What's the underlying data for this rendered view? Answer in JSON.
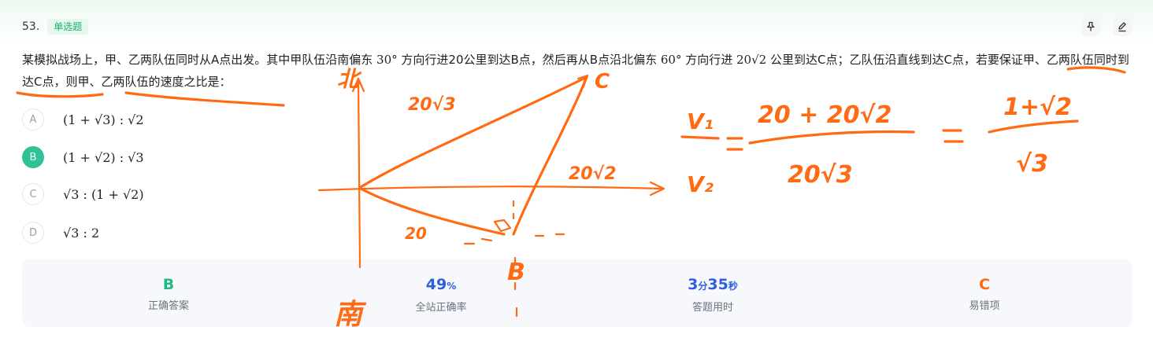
{
  "question": {
    "number": "53.",
    "type": "单选题",
    "stem_parts": [
      "某模拟战场上，甲、乙两队伍同时从A点出发。其中甲队伍沿南偏东 ",
      "30°",
      " 方向行进20公里到达B点，然后再从B点沿北偏东 ",
      "60°",
      " 方向行进 ",
      "20√2",
      " 公里到达C点；乙队伍沿直线到达C点，若要保证甲、乙两队伍同时到达C点，则甲、乙两队伍的速度之比是："
    ]
  },
  "toolbar": {
    "pin_icon": "pin-icon",
    "edit_icon": "edit-icon"
  },
  "options": [
    {
      "letter": "A",
      "text": "(1 + √3) : √2",
      "selected": false
    },
    {
      "letter": "B",
      "text": "(1 + √2) : √3",
      "selected": true
    },
    {
      "letter": "C",
      "text": "√3 : (1 + √2)",
      "selected": false
    },
    {
      "letter": "D",
      "text": "√3 : 2",
      "selected": false
    }
  ],
  "stats": {
    "answer": {
      "value": "B",
      "label": "正确答案",
      "color": "#20b97f"
    },
    "accuracy": {
      "value": "49",
      "unit": "%",
      "label": "全站正确率",
      "color": "#2f5fe0"
    },
    "time": {
      "min": "3",
      "min_unit": "分",
      "sec": "35",
      "sec_unit": "秒",
      "label": "答题用时",
      "color": "#2f5fe0"
    },
    "common_wrong": {
      "value": "C",
      "label": "易错项",
      "color": "#ff6a13"
    }
  },
  "annotations": {
    "north": "北",
    "south": "南",
    "label_B": "B",
    "label_C": "C",
    "len_AC": "20√3",
    "len_BC": "20√2",
    "len_AB": "20",
    "eq_v1": "V₁",
    "eq_v2": "V₂",
    "eq_num": "20 + 20√2",
    "eq_den": "20√3",
    "res_num": "1+√2",
    "res_den": "√3",
    "ink_color": "#ff6a13"
  }
}
